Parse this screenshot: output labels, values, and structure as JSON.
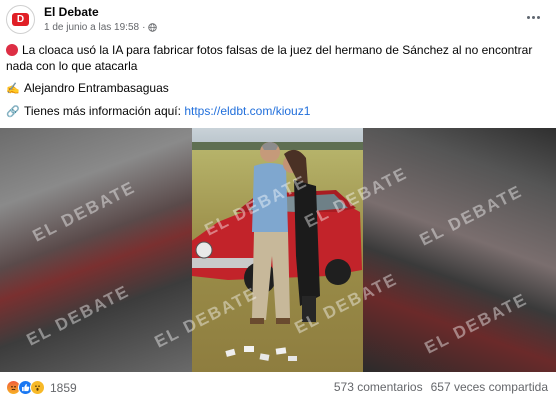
{
  "post": {
    "page_name": "El Debate",
    "avatar_letter": "D",
    "timestamp": "1 de junio a las 19:58",
    "separator": "·",
    "headline": "La cloaca usó la IA para fabricar fotos falsas de la juez del hermano de Sánchez al no encontrar nada con lo que atacarla",
    "author_emoji": "✍",
    "author": "Alejandro Entrambasaguas",
    "link_emoji": "🔗",
    "info_prefix": "Tienes más información aquí:",
    "link": "https://eldbt.com/kiouz1"
  },
  "media": {
    "watermarks": [
      "EL DEBATE",
      "EL DEBATE",
      "EL DEBATE",
      "EL DEBATE",
      "EL DEBATE",
      "EL DEBATE",
      "EL DEBATE",
      "EL DEBATE"
    ]
  },
  "footer": {
    "reaction_count": "1859",
    "comments": "573 comentarios",
    "shares": "657 veces compartida"
  },
  "icons": {
    "reactions": [
      "angry-icon",
      "like-icon",
      "wow-icon"
    ],
    "more": "more-options-icon",
    "audience": "globe-icon"
  },
  "colors": {
    "brand": "#e01f26",
    "link": "#216fdb",
    "like": "#1877f2"
  }
}
